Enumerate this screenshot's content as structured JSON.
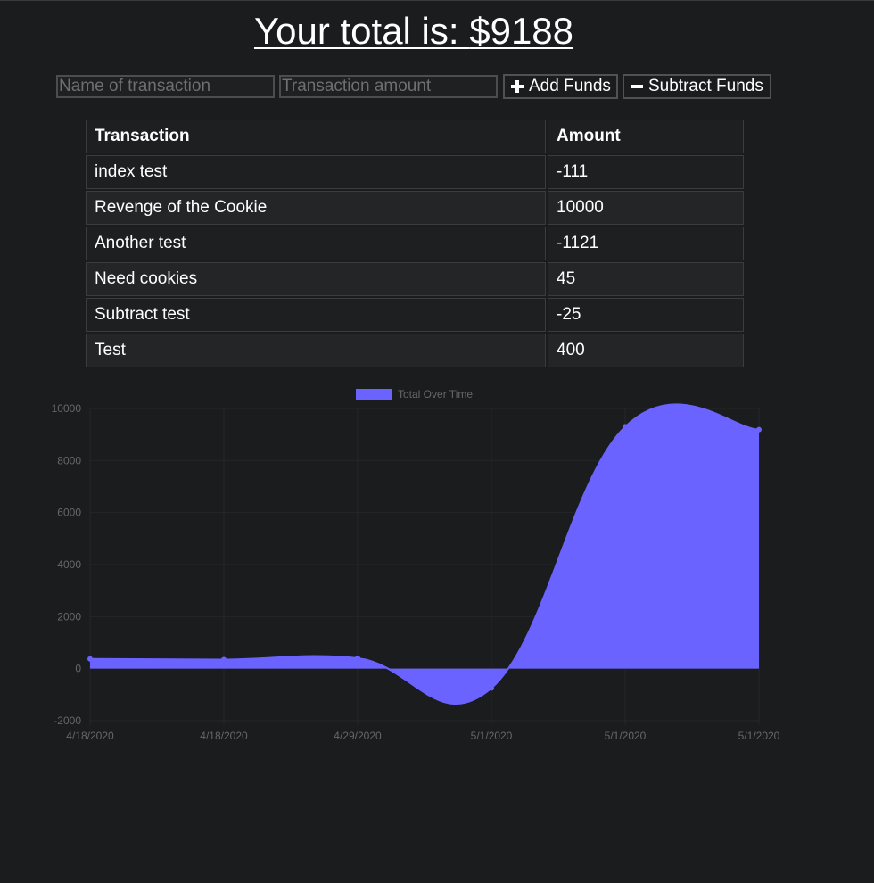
{
  "header": {
    "title_prefix": "Your total is: ",
    "total": "$9188"
  },
  "form": {
    "name_placeholder": "Name of transaction",
    "amount_placeholder": "Transaction amount",
    "add_label": "Add Funds",
    "subtract_label": "Subtract Funds"
  },
  "table": {
    "headers": [
      "Transaction",
      "Amount"
    ],
    "rows": [
      {
        "name": "index test",
        "amount": "-111"
      },
      {
        "name": "Revenge of the Cookie",
        "amount": "10000"
      },
      {
        "name": "Another test",
        "amount": "-1121"
      },
      {
        "name": "Need cookies",
        "amount": "45"
      },
      {
        "name": "Subtract test",
        "amount": "-25"
      },
      {
        "name": "Test",
        "amount": "400"
      }
    ]
  },
  "colors": {
    "series": "#6b63ff",
    "background": "#1b1c1e"
  },
  "chart_data": {
    "type": "area",
    "categories": [
      "4/18/2020",
      "4/18/2020",
      "4/29/2020",
      "5/1/2020",
      "5/1/2020",
      "5/1/2020"
    ],
    "series": [
      {
        "name": "Total Over Time",
        "values": [
          375,
          350,
          400,
          -750,
          9300,
          9188
        ]
      }
    ],
    "ylim": [
      -2000,
      10000
    ],
    "yticks": [
      -2000,
      0,
      2000,
      4000,
      6000,
      8000,
      10000
    ],
    "grid": true,
    "legend": "top",
    "title": "",
    "xlabel": "",
    "ylabel": ""
  }
}
